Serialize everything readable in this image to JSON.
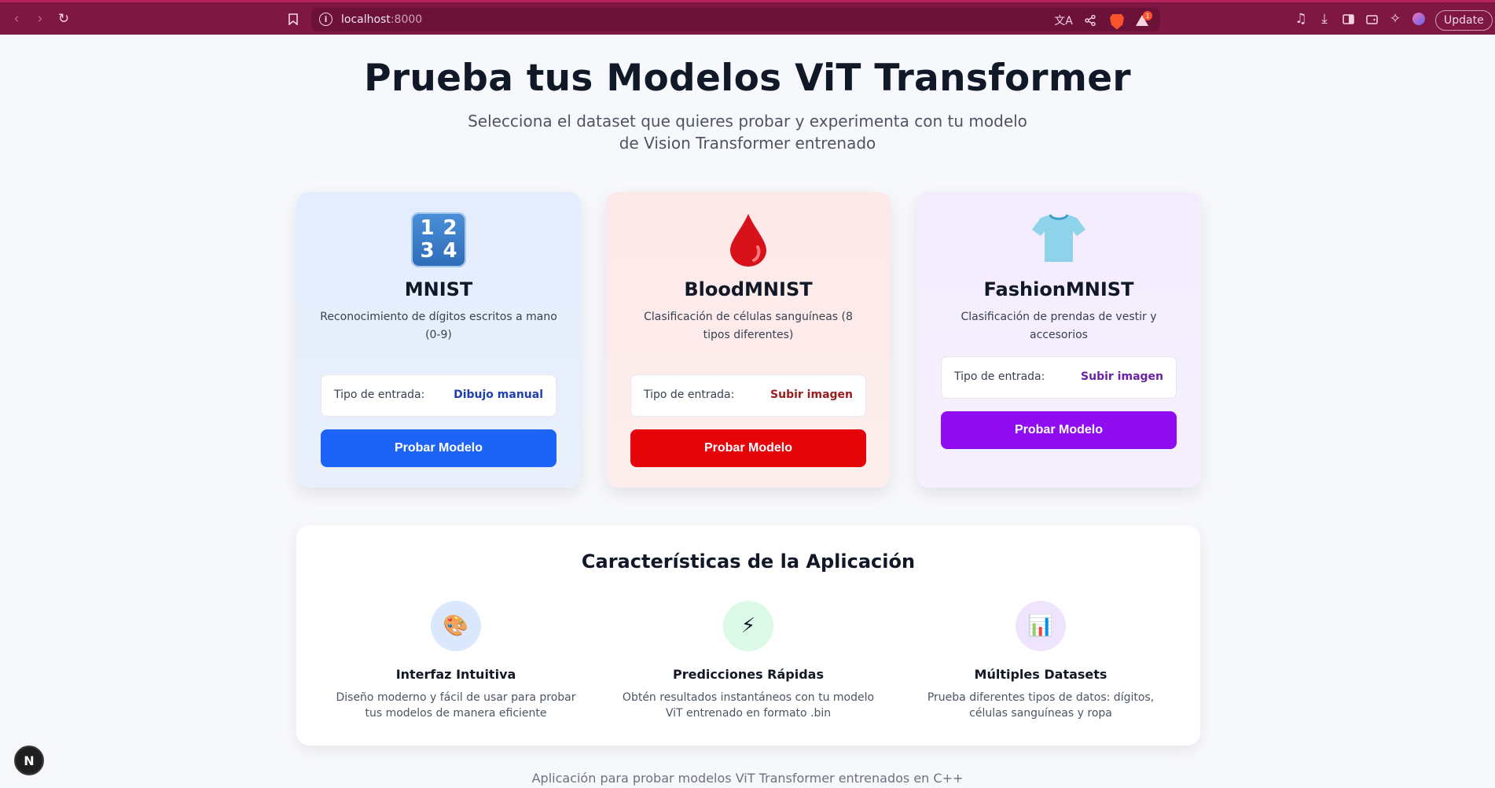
{
  "browser": {
    "url_host": "localhost",
    "url_port": ":8000",
    "update_label": "Update",
    "rewards_count": "1"
  },
  "hero": {
    "title": "Prueba tus Modelos ViT Transformer",
    "subtitle": "Selecciona el dataset que quieres probar y experimenta con tu modelo de Vision Transformer entrenado"
  },
  "datasets": [
    {
      "name": "MNIST",
      "description": "Reconocimiento de dígitos escritos a mano (0-9)",
      "input_label": "Tipo de entrada:",
      "input_type": "Dibujo manual",
      "button_label": "Probar Modelo",
      "icon": "keycap-1234-icon",
      "accent": "#1d63f5",
      "keycap_digits": [
        "1",
        "2",
        "3",
        "4"
      ]
    },
    {
      "name": "BloodMNIST",
      "description": "Clasificación de células sanguíneas (8 tipos diferentes)",
      "input_label": "Tipo de entrada:",
      "input_type": "Subir imagen",
      "button_label": "Probar Modelo",
      "icon": "blood-drop-icon",
      "accent": "#e5040a"
    },
    {
      "name": "FashionMNIST",
      "description": "Clasificación de prendas de vestir y accesorios",
      "input_label": "Tipo de entrada:",
      "input_type": "Subir imagen",
      "button_label": "Probar Modelo",
      "icon": "t-shirt-icon",
      "accent": "#8f0df0"
    }
  ],
  "features": {
    "title": "Características de la Aplicación",
    "items": [
      {
        "title": "Interfaz Intuitiva",
        "text": "Diseño moderno y fácil de usar para probar tus modelos de manera eficiente",
        "icon": "🎨"
      },
      {
        "title": "Predicciones Rápidas",
        "text": "Obtén resultados instantáneos con tu modelo ViT entrenado en formato .bin",
        "icon": "⚡"
      },
      {
        "title": "Múltiples Datasets",
        "text": "Prueba diferentes tipos de datos: dígitos, células sanguíneas y ropa",
        "icon": "📊"
      }
    ]
  },
  "footer": {
    "text": "Aplicación para probar modelos ViT Transformer entrenados en C++"
  },
  "nextjs_badge": "N"
}
